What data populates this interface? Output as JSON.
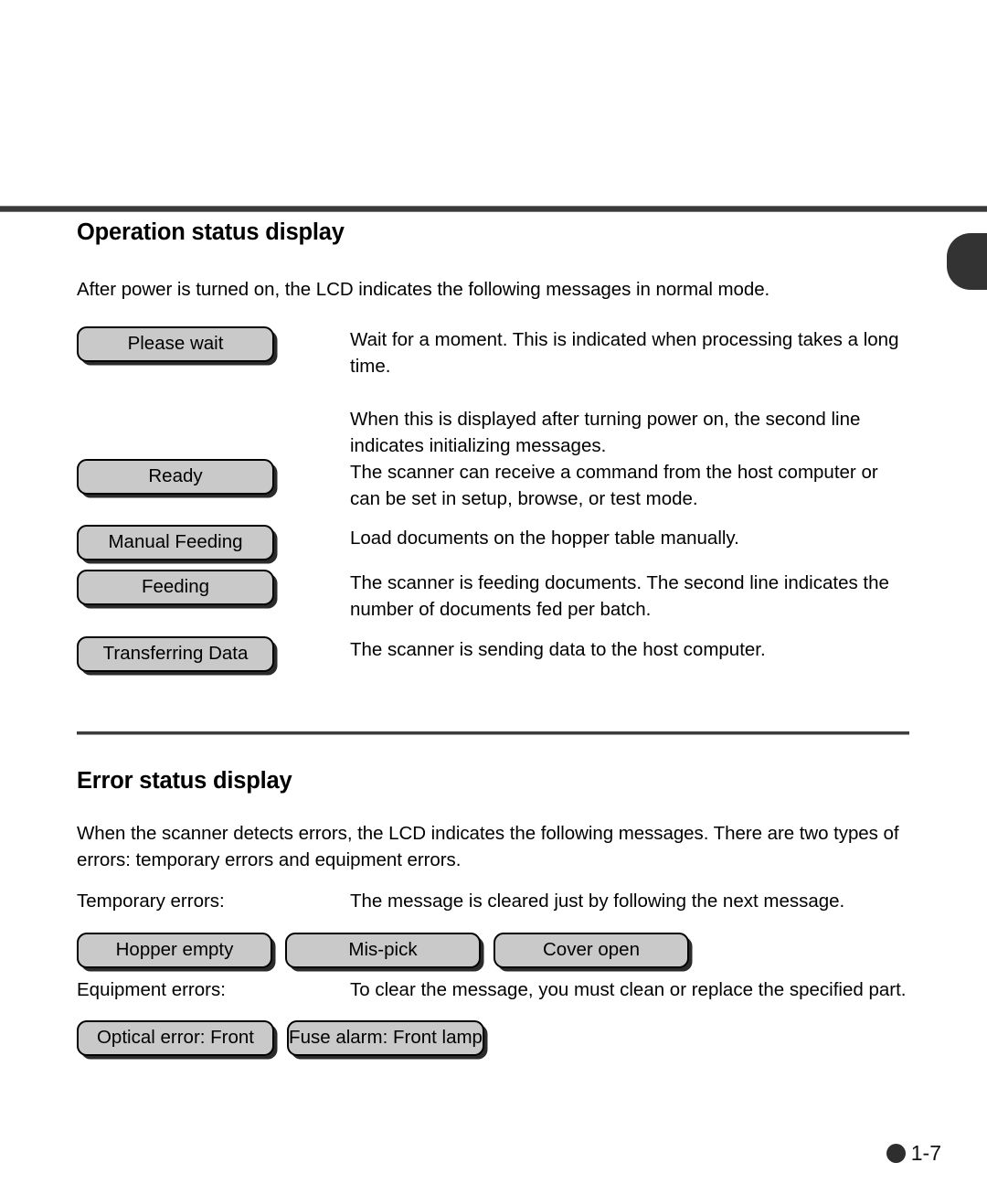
{
  "page": {
    "footer_marker": "●",
    "footer_page_number": "1-7",
    "edge_tab_color": "#333333",
    "rule_color": "#3a3a3a",
    "lcd_fill_color": "#c9c9c9",
    "lcd_border_color": "#000000"
  },
  "operation_section": {
    "title": "Operation status display",
    "intro": "After power is turned on, the LCD indicates the following messages in normal mode.",
    "rows": [
      {
        "lcd_label": "Please wait",
        "descriptions": [
          "Wait for a moment.  This is indicated when processing takes a long time.",
          "When this is displayed after turning power on, the second line indicates initializing messages."
        ]
      },
      {
        "lcd_label": "Ready",
        "descriptions": [
          "The scanner can receive a command from the host computer  or can be set in setup, browse, or test mode."
        ]
      },
      {
        "lcd_label": "Manual Feeding",
        "descriptions": [
          "Load documents on the hopper table manually."
        ]
      },
      {
        "lcd_label": "Feeding",
        "descriptions": [
          "The scanner is feeding documents.  The second line indicates the number of documents fed per batch."
        ]
      },
      {
        "lcd_label": "Transferring Data",
        "descriptions": [
          "The scanner is sending data to the host computer."
        ]
      }
    ]
  },
  "error_section": {
    "title": "Error status display",
    "intro": "When the scanner detects errors, the LCD indicates the following messages.  There are two types of errors: temporary errors and equipment errors.",
    "temporary": {
      "label": "Temporary errors:",
      "description": "The message is cleared just by following the next message.",
      "lcd_labels": [
        "Hopper empty",
        "Mis-pick",
        "Cover open"
      ]
    },
    "equipment": {
      "label": "Equipment errors:",
      "description": "To clear the message, you must clean or replace the specified part.",
      "lcd_labels": [
        "Optical error: Front",
        "Fuse alarm: Front lamp"
      ]
    }
  }
}
